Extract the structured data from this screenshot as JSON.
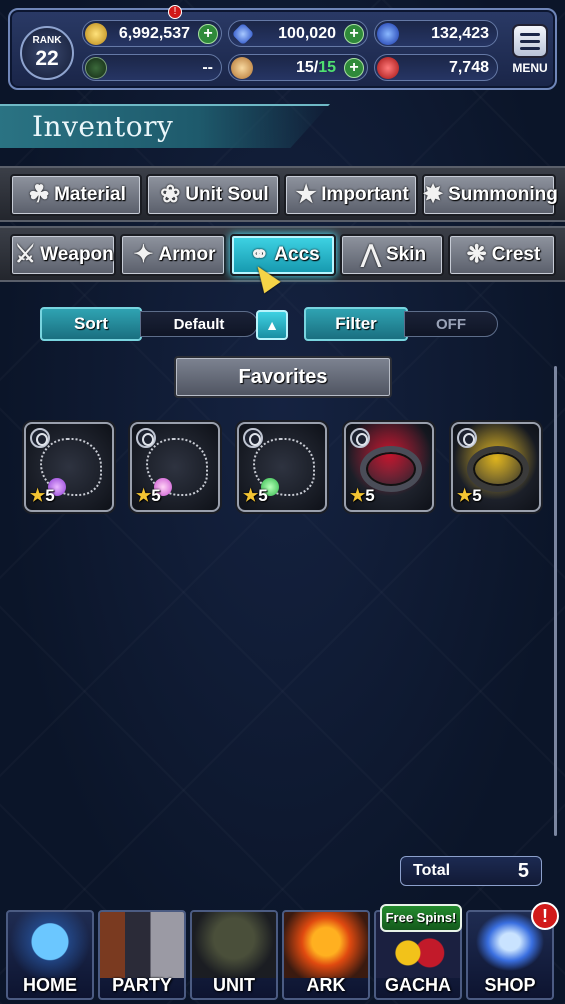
{
  "topbar": {
    "rank_label": "RANK",
    "rank_value": "22",
    "gil": "6,992,537",
    "lapis": "100,020",
    "blue_currency": "132,423",
    "guild_value": "--",
    "stamina_current": "15",
    "stamina_separator": "/",
    "stamina_max": "15",
    "red_currency": "7,748",
    "menu_label": "MENU",
    "alert_mark": "!",
    "plus": "+"
  },
  "header": {
    "title": "Inventory"
  },
  "tabs_row1": [
    {
      "label": "Material",
      "icon": "bag-icon"
    },
    {
      "label": "Unit Soul",
      "icon": "soul-icon"
    },
    {
      "label": "Important",
      "icon": "star-icon"
    },
    {
      "label": "Summoning",
      "icon": "summon-icon"
    }
  ],
  "tabs_row2": [
    {
      "label": "Weapon",
      "icon": "sword-icon"
    },
    {
      "label": "Armor",
      "icon": "armor-icon"
    },
    {
      "label": "Accs",
      "icon": "necklace-icon",
      "active": true
    },
    {
      "label": "Skin",
      "icon": "hanger-icon"
    },
    {
      "label": "Crest",
      "icon": "crest-icon"
    }
  ],
  "controls": {
    "sort_label": "Sort",
    "sort_value": "Default",
    "sort_dir_glyph": "▲",
    "filter_label": "Filter",
    "filter_value": "OFF",
    "favorites_label": "Favorites"
  },
  "items": [
    {
      "rarity": "5",
      "type": "necklace",
      "gem_color": "#8d3bd6"
    },
    {
      "rarity": "5",
      "type": "necklace",
      "gem_color": "#c84fd0"
    },
    {
      "rarity": "5",
      "type": "necklace",
      "gem_color": "#2fb84a"
    },
    {
      "rarity": "5",
      "type": "ring",
      "gem_color": "#e0102a"
    },
    {
      "rarity": "5",
      "type": "ring",
      "gem_color": "#f2c21a"
    }
  ],
  "total": {
    "label": "Total",
    "value": "5"
  },
  "nav": [
    {
      "label": "HOME",
      "icon": "home-icon"
    },
    {
      "label": "PARTY",
      "icon": "party-icon"
    },
    {
      "label": "UNIT",
      "icon": "unit-icon"
    },
    {
      "label": "ARK",
      "icon": "ark-icon"
    },
    {
      "label": "GACHA",
      "icon": "gacha-icon"
    },
    {
      "label": "SHOP",
      "icon": "shop-icon"
    }
  ],
  "gacha_badge": "Free Spins!",
  "shop_alert": "!",
  "colors": {
    "accent_cyan": "#3fd4e5",
    "background": "#0b1529",
    "star_gold": "#f4c533",
    "green_plus": "#2f8a3a"
  }
}
